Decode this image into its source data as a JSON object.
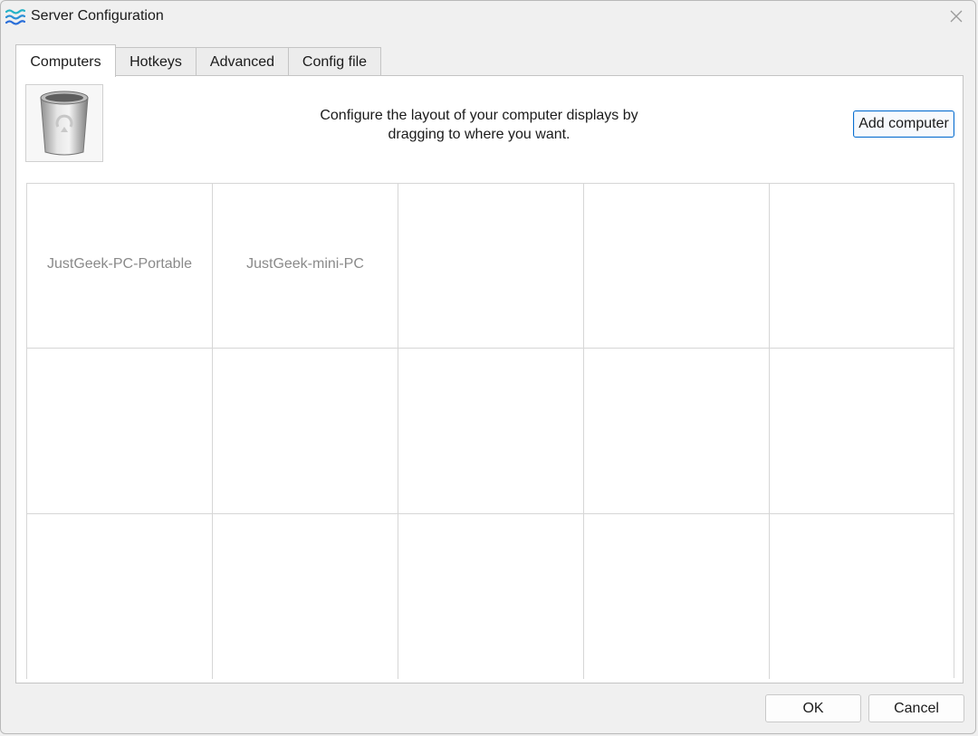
{
  "window": {
    "title": "Server Configuration",
    "app_icon": "waves-icon",
    "close_icon": "close-icon"
  },
  "tabs": [
    {
      "label": "Computers",
      "active": true
    },
    {
      "label": "Hotkeys",
      "active": false
    },
    {
      "label": "Advanced",
      "active": false
    },
    {
      "label": "Config file",
      "active": false
    }
  ],
  "computers_tab": {
    "trash_icon": "trash-bin-icon",
    "instructions_line1": "Configure the layout of your computer displays by",
    "instructions_line2": "dragging to where you want.",
    "add_button_label": "Add computer",
    "grid": [
      [
        "JustGeek-PC-Portable",
        "JustGeek-mini-PC",
        "",
        "",
        ""
      ],
      [
        "",
        "",
        "",
        "",
        ""
      ],
      [
        "",
        "",
        "",
        "",
        ""
      ]
    ]
  },
  "footer": {
    "ok_label": "OK",
    "cancel_label": "Cancel"
  },
  "colors": {
    "accent": "#0a6fd0",
    "app_icon_blue": "#2b7bd9",
    "app_icon_teal": "#26b3c6"
  }
}
